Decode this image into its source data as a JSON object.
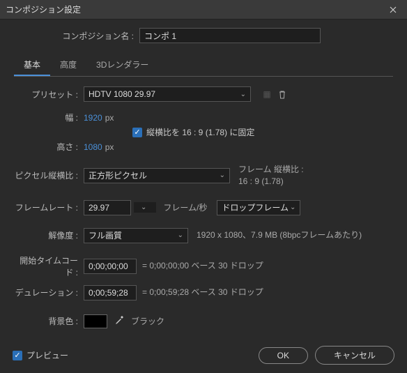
{
  "window": {
    "title": "コンポジション設定"
  },
  "comp_name": {
    "label": "コンポジション名 :",
    "value": "コンポ 1"
  },
  "tabs": {
    "basic": "基本",
    "advanced": "高度",
    "renderer": "3Dレンダラー"
  },
  "preset": {
    "label": "プリセット :",
    "value": "HDTV 1080 29.97"
  },
  "width": {
    "label": "幅 :",
    "value": "1920",
    "unit": "px"
  },
  "height": {
    "label": "高さ :",
    "value": "1080",
    "unit": "px"
  },
  "lock_aspect": {
    "label": "縦横比を 16 : 9 (1.78) に固定"
  },
  "pixel_aspect": {
    "label": "ピクセル縦横比 :",
    "value": "正方形ピクセル",
    "side_label": "フレーム 縦横比 :",
    "side_value": "16 : 9 (1.78)"
  },
  "framerate": {
    "label": "フレームレート :",
    "value": "29.97",
    "unit_label": "フレーム/秒",
    "drop": "ドロップフレーム"
  },
  "resolution": {
    "label": "解像度 :",
    "value": "フル画質",
    "info": "1920 x 1080、7.9 MB (8bpcフレームあたり)"
  },
  "start_tc": {
    "label": "開始タイムコード :",
    "value": "0;00;00;00",
    "info": "= 0;00;00;00 ベース 30 ドロップ"
  },
  "duration": {
    "label": "デュレーション :",
    "value": "0;00;59;28",
    "info": "= 0;00;59;28 ベース 30 ドロップ"
  },
  "bgcolor": {
    "label": "背景色 :",
    "name": "ブラック"
  },
  "footer": {
    "preview": "プレビュー",
    "ok": "OK",
    "cancel": "キャンセル"
  }
}
